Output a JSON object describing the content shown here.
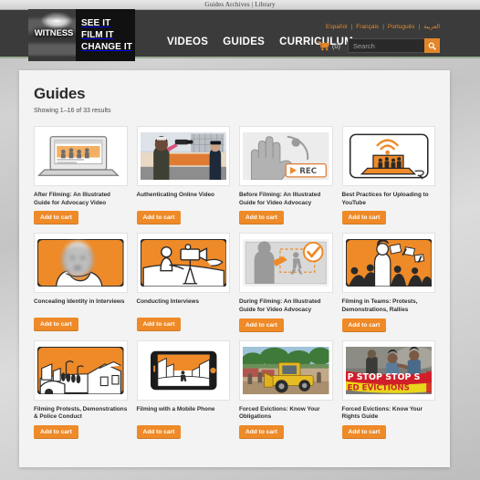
{
  "browser": {
    "title": "Guides Archives | Library"
  },
  "colors": {
    "header_bg": "#3b3b3b",
    "accent_orange": "#ee8a28",
    "accent_green": "#9aab92",
    "page_bg": "#f3f3f3"
  },
  "header": {
    "logo": {
      "wordmark": "WITNESS",
      "taglines": [
        "SEE IT",
        "FILM IT",
        "CHANGE IT"
      ]
    },
    "nav": [
      {
        "label": "VIDEOS",
        "name": "nav-videos"
      },
      {
        "label": "GUIDES",
        "name": "nav-guides"
      },
      {
        "label": "CURRICULUM",
        "name": "nav-curriculum"
      }
    ],
    "languages": [
      {
        "label": "Español"
      },
      {
        "label": "Français"
      },
      {
        "label": "Português"
      },
      {
        "label": "العربية"
      }
    ],
    "lang_separator": "|",
    "cart": {
      "count_label": "(0)"
    },
    "search": {
      "placeholder": "Search",
      "value": ""
    }
  },
  "main": {
    "title": "Guides",
    "result_count": "Showing 1–16 of 33 results",
    "add_to_cart_label": "Add to cart",
    "products": [
      {
        "title": "After Filming: An Illustrated Guide for Advocacy Video",
        "thumb": "laptop-illustration"
      },
      {
        "title": "Authenticating Online Video",
        "thumb": "photo-protester-filming"
      },
      {
        "title": "Before Filming: An Illustrated Guide for Video Advocacy",
        "thumb": "hand-rec-illustration"
      },
      {
        "title": "Best Practices for Uploading to YouTube",
        "thumb": "laptop-wifi-illustration"
      },
      {
        "title": "Concealing Identity in Interviews",
        "thumb": "blurred-face-illustration"
      },
      {
        "title": "Conducting Interviews",
        "thumb": "camera-interview-illustration"
      },
      {
        "title": "During Filming: An Illustrated Guide for Video Advocacy",
        "thumb": "framing-check-illustration"
      },
      {
        "title": "Filming in Teams: Protests, Demonstrations, Rallies",
        "thumb": "crowd-protest-illustration"
      },
      {
        "title": "Filming Protests, Demonstrations & Police Conduct",
        "thumb": "street-scene-illustration"
      },
      {
        "title": "Filming with a Mobile Phone",
        "thumb": "mobile-phone-illustration"
      },
      {
        "title": "Forced Evictions: Know Your Obligations",
        "thumb": "photo-bulldozer"
      },
      {
        "title": "Forced Evictions: Know Your Rights Guide",
        "thumb": "photo-stop-evictions-banner"
      }
    ]
  }
}
